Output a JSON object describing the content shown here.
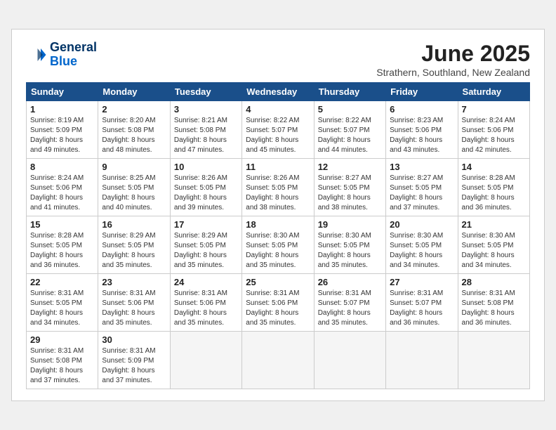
{
  "header": {
    "logo_line1": "General",
    "logo_line2": "Blue",
    "month": "June 2025",
    "location": "Strathern, Southland, New Zealand"
  },
  "weekdays": [
    "Sunday",
    "Monday",
    "Tuesday",
    "Wednesday",
    "Thursday",
    "Friday",
    "Saturday"
  ],
  "days": [
    {
      "num": "",
      "detail": ""
    },
    {
      "num": "",
      "detail": ""
    },
    {
      "num": "",
      "detail": ""
    },
    {
      "num": "",
      "detail": ""
    },
    {
      "num": "",
      "detail": ""
    },
    {
      "num": "",
      "detail": ""
    },
    {
      "num": "7",
      "detail": "Sunrise: 8:24 AM\nSunset: 5:06 PM\nDaylight: 8 hours\nand 42 minutes."
    },
    {
      "num": "1",
      "detail": "Sunrise: 8:19 AM\nSunset: 5:09 PM\nDaylight: 8 hours\nand 49 minutes."
    },
    {
      "num": "2",
      "detail": "Sunrise: 8:20 AM\nSunset: 5:08 PM\nDaylight: 8 hours\nand 48 minutes."
    },
    {
      "num": "3",
      "detail": "Sunrise: 8:21 AM\nSunset: 5:08 PM\nDaylight: 8 hours\nand 47 minutes."
    },
    {
      "num": "4",
      "detail": "Sunrise: 8:22 AM\nSunset: 5:07 PM\nDaylight: 8 hours\nand 45 minutes."
    },
    {
      "num": "5",
      "detail": "Sunrise: 8:22 AM\nSunset: 5:07 PM\nDaylight: 8 hours\nand 44 minutes."
    },
    {
      "num": "6",
      "detail": "Sunrise: 8:23 AM\nSunset: 5:06 PM\nDaylight: 8 hours\nand 43 minutes."
    },
    {
      "num": "7",
      "detail": "Sunrise: 8:24 AM\nSunset: 5:06 PM\nDaylight: 8 hours\nand 42 minutes."
    },
    {
      "num": "8",
      "detail": "Sunrise: 8:24 AM\nSunset: 5:06 PM\nDaylight: 8 hours\nand 41 minutes."
    },
    {
      "num": "9",
      "detail": "Sunrise: 8:25 AM\nSunset: 5:05 PM\nDaylight: 8 hours\nand 40 minutes."
    },
    {
      "num": "10",
      "detail": "Sunrise: 8:26 AM\nSunset: 5:05 PM\nDaylight: 8 hours\nand 39 minutes."
    },
    {
      "num": "11",
      "detail": "Sunrise: 8:26 AM\nSunset: 5:05 PM\nDaylight: 8 hours\nand 38 minutes."
    },
    {
      "num": "12",
      "detail": "Sunrise: 8:27 AM\nSunset: 5:05 PM\nDaylight: 8 hours\nand 38 minutes."
    },
    {
      "num": "13",
      "detail": "Sunrise: 8:27 AM\nSunset: 5:05 PM\nDaylight: 8 hours\nand 37 minutes."
    },
    {
      "num": "14",
      "detail": "Sunrise: 8:28 AM\nSunset: 5:05 PM\nDaylight: 8 hours\nand 36 minutes."
    },
    {
      "num": "15",
      "detail": "Sunrise: 8:28 AM\nSunset: 5:05 PM\nDaylight: 8 hours\nand 36 minutes."
    },
    {
      "num": "16",
      "detail": "Sunrise: 8:29 AM\nSunset: 5:05 PM\nDaylight: 8 hours\nand 35 minutes."
    },
    {
      "num": "17",
      "detail": "Sunrise: 8:29 AM\nSunset: 5:05 PM\nDaylight: 8 hours\nand 35 minutes."
    },
    {
      "num": "18",
      "detail": "Sunrise: 8:30 AM\nSunset: 5:05 PM\nDaylight: 8 hours\nand 35 minutes."
    },
    {
      "num": "19",
      "detail": "Sunrise: 8:30 AM\nSunset: 5:05 PM\nDaylight: 8 hours\nand 35 minutes."
    },
    {
      "num": "20",
      "detail": "Sunrise: 8:30 AM\nSunset: 5:05 PM\nDaylight: 8 hours\nand 34 minutes."
    },
    {
      "num": "21",
      "detail": "Sunrise: 8:30 AM\nSunset: 5:05 PM\nDaylight: 8 hours\nand 34 minutes."
    },
    {
      "num": "22",
      "detail": "Sunrise: 8:31 AM\nSunset: 5:05 PM\nDaylight: 8 hours\nand 34 minutes."
    },
    {
      "num": "23",
      "detail": "Sunrise: 8:31 AM\nSunset: 5:06 PM\nDaylight: 8 hours\nand 35 minutes."
    },
    {
      "num": "24",
      "detail": "Sunrise: 8:31 AM\nSunset: 5:06 PM\nDaylight: 8 hours\nand 35 minutes."
    },
    {
      "num": "25",
      "detail": "Sunrise: 8:31 AM\nSunset: 5:06 PM\nDaylight: 8 hours\nand 35 minutes."
    },
    {
      "num": "26",
      "detail": "Sunrise: 8:31 AM\nSunset: 5:07 PM\nDaylight: 8 hours\nand 35 minutes."
    },
    {
      "num": "27",
      "detail": "Sunrise: 8:31 AM\nSunset: 5:07 PM\nDaylight: 8 hours\nand 36 minutes."
    },
    {
      "num": "28",
      "detail": "Sunrise: 8:31 AM\nSunset: 5:08 PM\nDaylight: 8 hours\nand 36 minutes."
    },
    {
      "num": "29",
      "detail": "Sunrise: 8:31 AM\nSunset: 5:08 PM\nDaylight: 8 hours\nand 37 minutes."
    },
    {
      "num": "30",
      "detail": "Sunrise: 8:31 AM\nSunset: 5:09 PM\nDaylight: 8 hours\nand 37 minutes."
    },
    {
      "num": "",
      "detail": ""
    },
    {
      "num": "",
      "detail": ""
    },
    {
      "num": "",
      "detail": ""
    },
    {
      "num": "",
      "detail": ""
    },
    {
      "num": "",
      "detail": ""
    }
  ]
}
